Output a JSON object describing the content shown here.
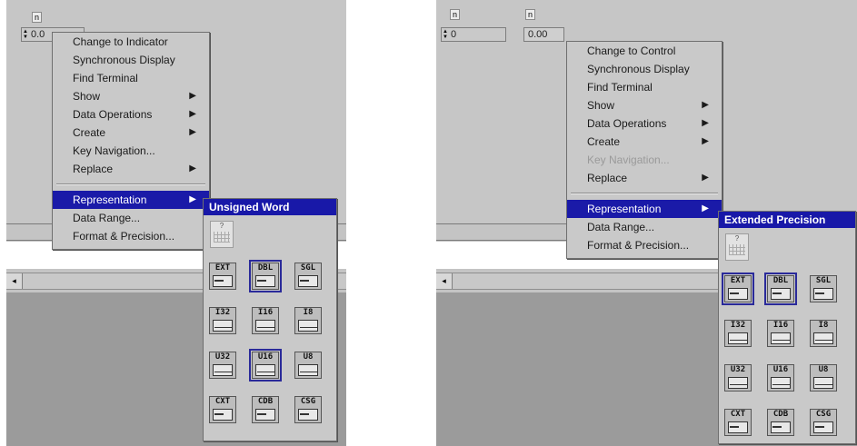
{
  "left": {
    "control_label": "n",
    "control_value": "0.0",
    "menu": {
      "items": [
        "Change to Indicator",
        "Synchronous Display",
        "Find Terminal",
        "Show",
        "Data Operations",
        "Create",
        "Key Navigation...",
        "Replace"
      ],
      "submenu_flags": [
        false,
        false,
        false,
        true,
        true,
        true,
        false,
        true
      ],
      "items2": [
        "Representation",
        "Data Range...",
        "Format & Precision..."
      ],
      "selected": "Representation"
    },
    "palette": {
      "title": "Unsigned Word",
      "blank_mark": "?",
      "codes": [
        "EXT",
        "DBL",
        "SGL",
        "I32",
        "I16",
        "I8",
        "U32",
        "U16",
        "U8",
        "CXT",
        "CDB",
        "CSG"
      ],
      "selected_codes": [
        "DBL",
        "U16"
      ]
    }
  },
  "right": {
    "control_label": "n",
    "control_value": "0",
    "indicator_label": "n",
    "indicator_value": "0.00",
    "menu": {
      "items": [
        "Change to Control",
        "Synchronous Display",
        "Find Terminal",
        "Show",
        "Data Operations",
        "Create",
        "Key Navigation...",
        "Replace"
      ],
      "submenu_flags": [
        false,
        false,
        false,
        true,
        true,
        true,
        false,
        true
      ],
      "disabled": [
        "Key Navigation..."
      ],
      "items2": [
        "Representation",
        "Data Range...",
        "Format & Precision..."
      ],
      "selected": "Representation"
    },
    "palette": {
      "title": "Extended Precision",
      "blank_mark": "?",
      "codes": [
        "EXT",
        "DBL",
        "SGL",
        "I32",
        "I16",
        "I8",
        "U32",
        "U16",
        "U8",
        "CXT",
        "CDB",
        "CSG"
      ],
      "selected_codes": [
        "EXT",
        "DBL"
      ]
    }
  },
  "icons": {
    "submenu_arrow": "triangle-right-icon",
    "scroll_left": "scroll-left-arrow-icon",
    "increment_decrement": "incdec-icon"
  },
  "colors": {
    "highlight": "#1a1aa8",
    "panel_gray": "#c6c6c6",
    "dark_gray": "#9b9b9b"
  }
}
